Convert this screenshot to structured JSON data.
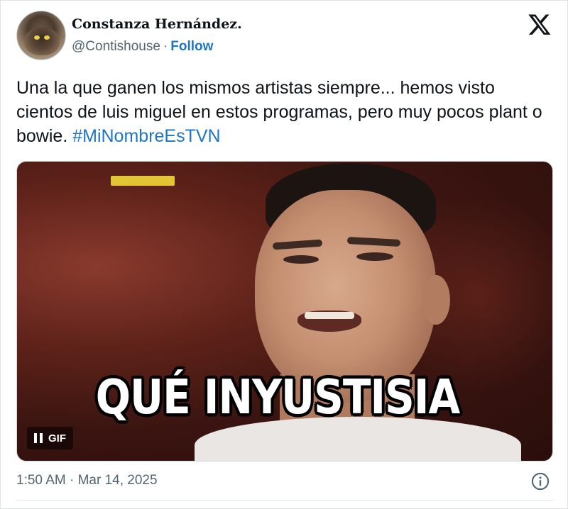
{
  "author": {
    "display_name": "Constanza Hernández.",
    "handle": "@Contishouse",
    "separator": "·",
    "follow_label": "Follow"
  },
  "tweet": {
    "text_before_hashtag": "Una la que ganen los mismos artistas siempre... hemos visto cientos de luis miguel en estos programas, pero muy pocos plant o bowie. ",
    "hashtag": "#MiNombreEsTVN"
  },
  "media": {
    "type": "gif",
    "caption": "QUÉ INYUSTISIA",
    "badge": "GIF",
    "pause_icon": "pause-icon"
  },
  "footer": {
    "timestamp": "1:50 AM · Mar 14, 2025",
    "info_icon": "info-icon"
  },
  "icons": {
    "brand": "x-logo-icon"
  },
  "colors": {
    "link": "#1d75c4",
    "text": "#0f1419",
    "muted": "#536471",
    "border": "#dfe3e6"
  }
}
